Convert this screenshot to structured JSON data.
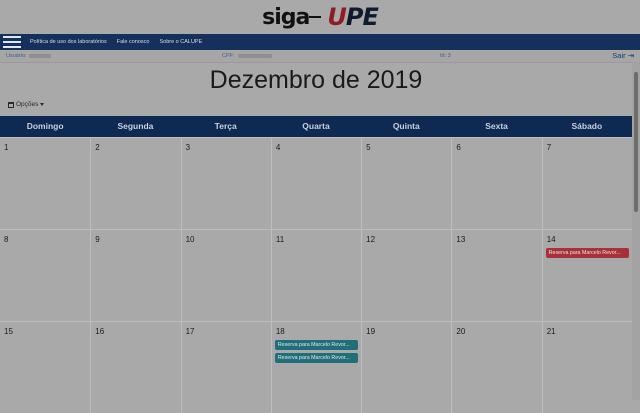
{
  "logo": {
    "siga": "siga",
    "up_u": "U",
    "up_pe": "PE"
  },
  "nav": {
    "links": [
      "Política de uso dos laboratórios",
      "Fale conosco",
      "Sobre o CALUPE"
    ]
  },
  "user": {
    "usuario_label": "Usuário:",
    "cpf_label": "CPF:",
    "id_label": "Id: 3",
    "sair": "Sair"
  },
  "calendar": {
    "title": "Dezembro de 2019",
    "options_label": "Opções",
    "weekdays": [
      "Domingo",
      "Segunda",
      "Terça",
      "Quarta",
      "Quinta",
      "Sexta",
      "Sábado"
    ],
    "weeks": [
      [
        "1",
        "2",
        "3",
        "4",
        "5",
        "6",
        "7"
      ],
      [
        "8",
        "9",
        "10",
        "11",
        "12",
        "13",
        "14"
      ],
      [
        "15",
        "16",
        "17",
        "18",
        "19",
        "20",
        "21"
      ]
    ],
    "events": [
      {
        "week": 1,
        "day": 6,
        "label": "Reserva para Marcelo Revor...",
        "color": "red"
      },
      {
        "week": 2,
        "day": 3,
        "label": "Reserva para Marcelo Revor...",
        "color": "teal"
      },
      {
        "week": 2,
        "day": 3,
        "label": "Reserva para Marcelo Revor...",
        "color": "teal"
      }
    ]
  },
  "colors": {
    "navbar": "#14305b",
    "header_row": "#0f2a52",
    "event_red": "#a83038",
    "event_teal": "#1f6e7a"
  }
}
